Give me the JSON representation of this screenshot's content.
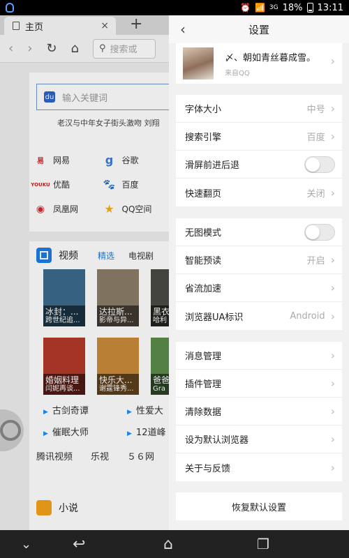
{
  "status_bar": {
    "time": "13:11",
    "battery": "18%",
    "network": "3G"
  },
  "browser": {
    "tab_title": "主页",
    "url_placeholder": "搜索或",
    "search_placeholder": "输入关键词",
    "hotwords": "老汉与中年女子街头激吻    刘翔",
    "sites": [
      "网易",
      "谷歌",
      "优酷",
      "百度",
      "凤凰网",
      "QQ空间"
    ],
    "video": {
      "title": "视频",
      "tab_selected": "精选",
      "tab_other": "电视剧",
      "posters": [
        {
          "title": "冰封：...",
          "sub": "跨世纪追...",
          "color": "#3b6a8c"
        },
        {
          "title": "达拉斯...",
          "sub": "影帝与异...",
          "color": "#8a7c68"
        },
        {
          "title": "黑衣",
          "sub": "哈利",
          "color": "#4a4a44"
        },
        {
          "title": "婚姻料理",
          "sub": "闫妮再谈...",
          "color": "#b23a2a"
        },
        {
          "title": "快乐大...",
          "sub": "谢霆锋秀...",
          "color": "#c98a3a"
        },
        {
          "title": "爸爸",
          "sub": "Gra",
          "color": "#5b8c4a"
        }
      ],
      "links": [
        "古剑奇谭",
        "性爱大",
        "催眠大师",
        "12道峰"
      ],
      "providers": [
        "腾讯视频",
        "乐视",
        "５６网"
      ]
    },
    "novel": {
      "title": "小说"
    }
  },
  "settings": {
    "title": "设置",
    "profile": {
      "name": "〆、朝如青丝暮成雪。",
      "source": "来自QQ"
    },
    "group1": [
      {
        "label": "字体大小",
        "value": "中号",
        "kind": "chevron"
      },
      {
        "label": "搜索引擎",
        "value": "百度",
        "kind": "chevron"
      },
      {
        "label": "滑屏前进后退",
        "value": "",
        "kind": "toggle"
      },
      {
        "label": "快速翻页",
        "value": "关闭",
        "kind": "chevron"
      }
    ],
    "group2": [
      {
        "label": "无图模式",
        "value": "",
        "kind": "toggle"
      },
      {
        "label": "智能预读",
        "value": "开启",
        "kind": "chevron"
      },
      {
        "label": "省流加速",
        "value": "",
        "kind": "chevron"
      },
      {
        "label": "浏览器UA标识",
        "value": "Android",
        "kind": "chevron"
      }
    ],
    "group3": [
      {
        "label": "消息管理"
      },
      {
        "label": "插件管理"
      },
      {
        "label": "清除数据"
      },
      {
        "label": "设为默认浏览器"
      },
      {
        "label": "关于与反馈"
      }
    ],
    "reset_label": "恢复默认设置"
  }
}
